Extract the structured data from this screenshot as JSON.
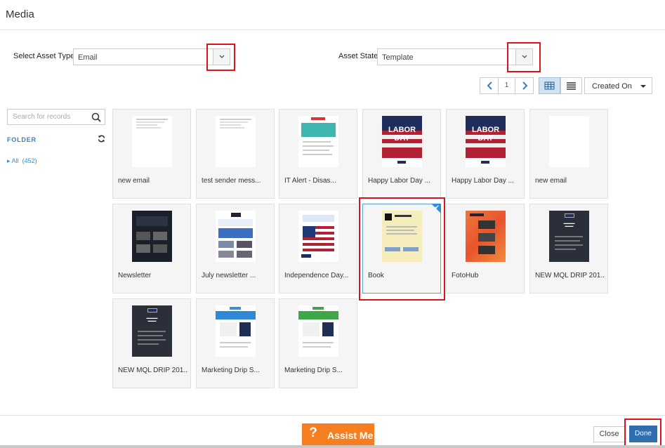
{
  "dialog": {
    "title": "Media"
  },
  "filters": {
    "asset_type_label": "Select Asset Type:",
    "asset_type_value": "Email",
    "asset_state_label": "Asset State:",
    "asset_state_value": "Template"
  },
  "toolbar": {
    "page_number": "1",
    "sort_value": "Created On"
  },
  "sidebar": {
    "search_placeholder": "Search for records",
    "folder_label": "FOLDER",
    "all_label": "All",
    "all_count": "(452)"
  },
  "cards": [
    {
      "name": "new email",
      "thumb": "blank-text",
      "selected": false
    },
    {
      "name": "test sender mess...",
      "thumb": "blank-text",
      "selected": false
    },
    {
      "name": "IT Alert - Disas...",
      "thumb": "teal-alert",
      "selected": false
    },
    {
      "name": "Happy Labor Day ...",
      "thumb": "labor-day",
      "selected": false
    },
    {
      "name": "Happy Labor Day ...",
      "thumb": "labor-day",
      "selected": false
    },
    {
      "name": "new email",
      "thumb": "blank",
      "selected": false
    },
    {
      "name": "Newsletter",
      "thumb": "dark-newsletter",
      "selected": false
    },
    {
      "name": "July newsletter ...",
      "thumb": "blue-newsletter",
      "selected": false
    },
    {
      "name": "Independence Day...",
      "thumb": "flag",
      "selected": false
    },
    {
      "name": "Book",
      "thumb": "book",
      "selected": true
    },
    {
      "name": "FotoHub",
      "thumb": "fotohub",
      "selected": false
    },
    {
      "name": "NEW MQL DRIP 201...",
      "thumb": "dark-mql",
      "selected": false
    },
    {
      "name": "NEW MQL DRIP 201...",
      "thumb": "dark-mql",
      "selected": false
    },
    {
      "name": "Marketing Drip S...",
      "thumb": "drip-blue",
      "selected": false
    },
    {
      "name": "Marketing Drip S...",
      "thumb": "drip-green",
      "selected": false
    }
  ],
  "footer": {
    "assist_icon": "?",
    "assist_label": "Assist Me",
    "close_label": "Close",
    "done_label": "Done"
  },
  "colors": {
    "highlight": "#d9141c",
    "accent": "#2f6fb0",
    "assist": "#f57f20"
  }
}
